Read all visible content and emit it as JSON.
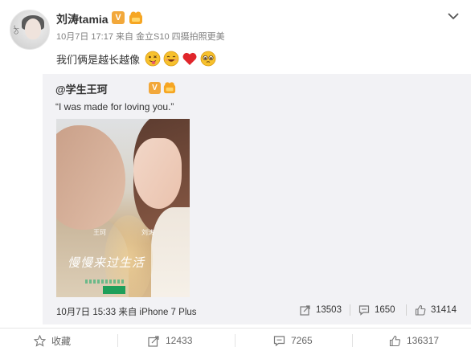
{
  "author": {
    "name": "刘涛tamia",
    "verified_mark": "V",
    "avatar_mark": "ঠ"
  },
  "post": {
    "meta": "10月7日 17:17 来自 金立S10 四摄拍照更美",
    "text": "我们俩是越长越像",
    "emojis": [
      "tongue-face-emoji",
      "grin-face-emoji",
      "red-heart-emoji",
      "pleading-face-emoji"
    ]
  },
  "repost": {
    "author": "@学生王珂",
    "verified_mark": "V",
    "text": "“I was made for loving you.”",
    "photo": {
      "credit_left": "王珂",
      "credit_right": "刘涛",
      "calligraphy": "慢慢来过生活"
    },
    "meta": "10月7日 15:33 来自 iPhone 7 Plus",
    "stats": {
      "reposts": "13503",
      "comments": "1650",
      "likes": "31414"
    }
  },
  "actions": {
    "favorite": "收藏",
    "reposts": "12433",
    "comments": "7265",
    "likes": "136317"
  },
  "colors": {
    "verified": "#f2a83b",
    "repost_bg": "#f2f2f5",
    "heart": "#e0262b"
  }
}
